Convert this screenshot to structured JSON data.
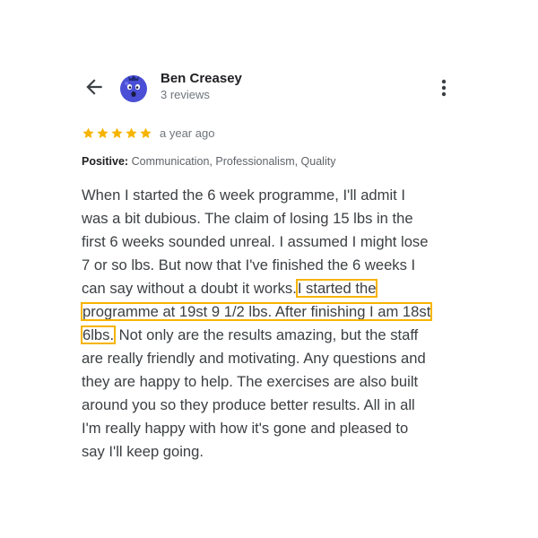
{
  "reviewer": {
    "name": "Ben Creasey",
    "review_count": "3 reviews"
  },
  "icons": {
    "back": "arrow-back-icon",
    "avatar": "blueberry-avatar-icon",
    "more": "more-vert-icon",
    "star": "star-icon"
  },
  "rating": {
    "stars": 5,
    "max_stars": 5,
    "date": "a year ago"
  },
  "attributes": {
    "label": "Positive:",
    "values": "Communication, Professionalism, Quality"
  },
  "review": {
    "lines": [
      [
        {
          "text": "When I started the 6 week programme, I'll admit I"
        }
      ],
      [
        {
          "text": "was a bit dubious. The claim of losing 15 lbs in the"
        }
      ],
      [
        {
          "text": "first 6 weeks sounded unreal. I assumed I might lose"
        }
      ],
      [
        {
          "text": "7 or so lbs. But now that I've finished the 6 weeks I"
        }
      ],
      [
        {
          "text": "can say without a doubt it works."
        },
        {
          "text": "I started the",
          "highlight": true
        }
      ],
      [
        {
          "text": "programme at 19st 9 1/2 lbs. After finishing I am 18st",
          "highlight": true
        }
      ],
      [
        {
          "text": "6lbs.",
          "highlight": true
        },
        {
          "text": " Not only are the results amazing, but the staff"
        }
      ],
      [
        {
          "text": "are really friendly and motivating. Any questions and"
        }
      ],
      [
        {
          "text": "they are happy to help. The exercises are also built"
        }
      ],
      [
        {
          "text": "around you so they produce better results. All in all"
        }
      ],
      [
        {
          "text": "I'm really happy with how it's gone and pleased to"
        }
      ],
      [
        {
          "text": "say I'll keep going."
        }
      ]
    ]
  },
  "colors": {
    "star": "#f6b400",
    "highlight_border": "#f6b400",
    "avatar_body": "#4a4fd6",
    "avatar_leaf": "#1f2a7a",
    "secondary_text": "#70757a"
  }
}
